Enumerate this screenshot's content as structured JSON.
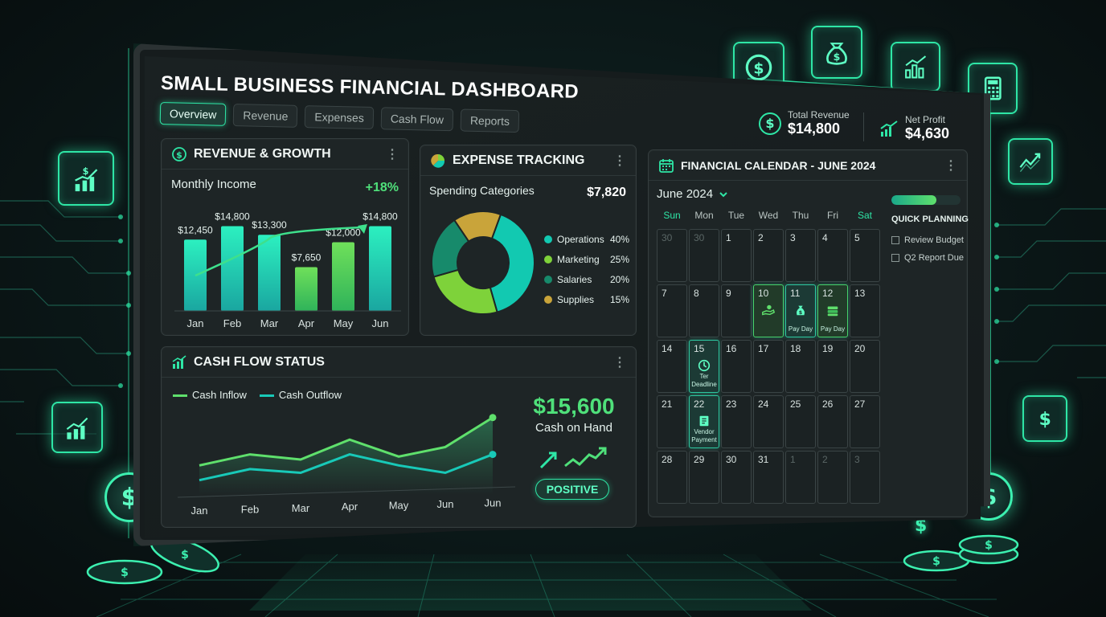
{
  "dashboard_title": "SMALL BUSINESS FINANCIAL DASHBOARD",
  "tabs": [
    {
      "label": "Overview",
      "active": true
    },
    {
      "label": "Revenue",
      "active": false
    },
    {
      "label": "Expenses",
      "active": false
    },
    {
      "label": "Cash Flow",
      "active": false
    },
    {
      "label": "Reports",
      "active": false
    }
  ],
  "kpis": {
    "total_revenue": {
      "label": "Total Revenue",
      "value": "$14,800",
      "icon": "dollar-icon"
    },
    "net_profit": {
      "label": "Net Profit",
      "value": "$4,630",
      "icon": "trend-up-icon"
    }
  },
  "menu_glyph": "⋮",
  "revenue_panel": {
    "title": "REVENUE & GROWTH",
    "subtitle": "Monthly Income",
    "growth": "+18%",
    "chart_data": {
      "type": "bar",
      "categories": [
        "Jan",
        "Feb",
        "Mar",
        "Apr",
        "May",
        "Jun"
      ],
      "values": [
        12450,
        14800,
        13300,
        7650,
        12000,
        14800
      ],
      "data_labels": [
        "$12,450",
        "$14,800",
        "$13,300",
        "$7,650",
        "$12,000",
        "$14,800"
      ],
      "trend_line": true,
      "ylim": [
        0,
        16000
      ]
    }
  },
  "expense_panel": {
    "title": "EXPENSE TRACKING",
    "subtitle": "Spending Categories",
    "total": "$7,820",
    "chart_data": {
      "type": "pie",
      "donut": true,
      "slices": [
        {
          "label": "Operations",
          "value": 40,
          "display": "40%",
          "color": "#12c9b1"
        },
        {
          "label": "Marketing",
          "value": 25,
          "display": "25%",
          "color": "#7ed23a"
        },
        {
          "label": "Salaries",
          "value": 20,
          "display": "20%",
          "color": "#178a6b"
        },
        {
          "label": "Supplies",
          "value": 15,
          "display": "15%",
          "color": "#c9a43a"
        }
      ]
    }
  },
  "cashflow_panel": {
    "title": "CASH FLOW STATUS",
    "chart_data": {
      "type": "line",
      "categories": [
        "Jan",
        "Feb",
        "Mar",
        "Apr",
        "May",
        "Jun",
        "Jun"
      ],
      "series": [
        {
          "name": "Cash Inflow",
          "color": "#5fe06c",
          "values": [
            40,
            55,
            48,
            75,
            52,
            65,
            105
          ]
        },
        {
          "name": "Cash Outflow",
          "color": "#18c9b8",
          "values": [
            20,
            35,
            30,
            55,
            40,
            30,
            55
          ]
        }
      ],
      "grid": false
    },
    "cash_on_hand_value": "$15,600",
    "cash_on_hand_label": "Cash on Hand",
    "status": "POSITIVE"
  },
  "calendar_panel": {
    "title": "FINANCIAL CALENDAR - JUNE 2024",
    "month_label": "June 2024",
    "weekdays": [
      "Sun",
      "Mon",
      "Tue",
      "Wed",
      "Thu",
      "Fri",
      "Sat"
    ],
    "days": [
      {
        "d": "30",
        "muted": true
      },
      {
        "d": "30",
        "muted": true
      },
      {
        "d": "1"
      },
      {
        "d": "2"
      },
      {
        "d": "3"
      },
      {
        "d": "4"
      },
      {
        "d": "5"
      },
      {
        "d": "7"
      },
      {
        "d": "8"
      },
      {
        "d": "9"
      },
      {
        "d": "10",
        "event": "green",
        "icon": "hand-money-icon",
        "label": ""
      },
      {
        "d": "11",
        "event": "teal",
        "icon": "money-bag-icon",
        "label": "Pay Day"
      },
      {
        "d": "12",
        "event": "green",
        "icon": "cash-stack-icon",
        "label": "Pay Day"
      },
      {
        "d": "13"
      },
      {
        "d": "14"
      },
      {
        "d": "15",
        "event": "teal",
        "icon": "clock-icon",
        "label": "Ter Deadline"
      },
      {
        "d": "16"
      },
      {
        "d": "17"
      },
      {
        "d": "18"
      },
      {
        "d": "19"
      },
      {
        "d": "20"
      },
      {
        "d": "21"
      },
      {
        "d": "22",
        "event": "teal",
        "icon": "invoice-icon",
        "label": "Vendor Payment"
      },
      {
        "d": "23"
      },
      {
        "d": "24"
      },
      {
        "d": "25"
      },
      {
        "d": "26"
      },
      {
        "d": "27"
      },
      {
        "d": "28"
      },
      {
        "d": "29"
      },
      {
        "d": "30"
      },
      {
        "d": "31"
      },
      {
        "d": "1",
        "muted": true
      },
      {
        "d": "2",
        "muted": true
      },
      {
        "d": "3",
        "muted": true
      }
    ],
    "quick_planning": {
      "title": "QUICK PLANNING",
      "progress": 0.65,
      "items": [
        "Review Budget",
        "Q2 Report Due"
      ]
    }
  },
  "decor": {
    "accent": "#2ee6a6",
    "dollar_glyph": "$"
  }
}
